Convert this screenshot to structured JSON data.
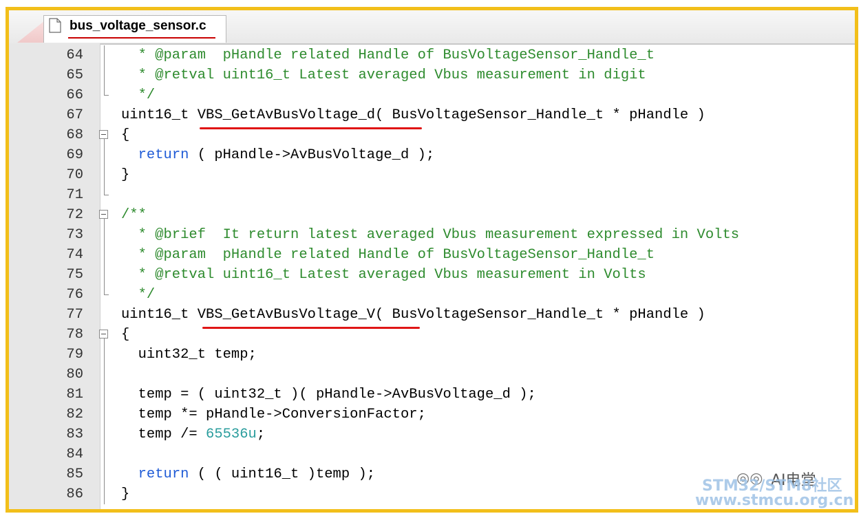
{
  "tab": {
    "filename": "bus_voltage_sensor.c"
  },
  "lines": [
    {
      "num": "64",
      "fold": "bar",
      "tokens": [
        [
          "cm",
          "  * @param  pHandle related Handle of BusVoltageSensor_Handle_t"
        ]
      ]
    },
    {
      "num": "65",
      "fold": "bar",
      "tokens": [
        [
          "cm",
          "  * @retval uint16_t Latest averaged Vbus measurement in digit"
        ]
      ]
    },
    {
      "num": "66",
      "fold": "end",
      "tokens": [
        [
          "cm",
          "  */"
        ]
      ]
    },
    {
      "num": "67",
      "fold": "none",
      "tokens": [
        [
          "",
          "uint16_t VBS_GetAvBusVoltage_d( BusVoltageSensor_Handle_t * pHandle )"
        ]
      ]
    },
    {
      "num": "68",
      "fold": "box",
      "tokens": [
        [
          "",
          "{"
        ]
      ]
    },
    {
      "num": "69",
      "fold": "bar",
      "tokens": [
        [
          "",
          "  "
        ],
        [
          "kw",
          "return"
        ],
        [
          "",
          " ( pHandle->AvBusVoltage_d );"
        ]
      ]
    },
    {
      "num": "70",
      "fold": "bar",
      "tokens": [
        [
          "",
          "}"
        ]
      ]
    },
    {
      "num": "71",
      "fold": "end",
      "tokens": [
        [
          "",
          ""
        ]
      ]
    },
    {
      "num": "72",
      "fold": "box",
      "tokens": [
        [
          "cm",
          "/**"
        ]
      ]
    },
    {
      "num": "73",
      "fold": "bar",
      "tokens": [
        [
          "cm",
          "  * @brief  It return latest averaged Vbus measurement expressed in Volts"
        ]
      ]
    },
    {
      "num": "74",
      "fold": "bar",
      "tokens": [
        [
          "cm",
          "  * @param  pHandle related Handle of BusVoltageSensor_Handle_t"
        ]
      ]
    },
    {
      "num": "75",
      "fold": "bar",
      "tokens": [
        [
          "cm",
          "  * @retval uint16_t Latest averaged Vbus measurement in Volts"
        ]
      ]
    },
    {
      "num": "76",
      "fold": "end",
      "tokens": [
        [
          "cm",
          "  */"
        ]
      ]
    },
    {
      "num": "77",
      "fold": "none",
      "tokens": [
        [
          "",
          "uint16_t VBS_GetAvBusVoltage_V( BusVoltageSensor_Handle_t * pHandle )"
        ]
      ]
    },
    {
      "num": "78",
      "fold": "box",
      "tokens": [
        [
          "",
          "{"
        ]
      ]
    },
    {
      "num": "79",
      "fold": "bar",
      "tokens": [
        [
          "",
          "  uint32_t temp;"
        ]
      ]
    },
    {
      "num": "80",
      "fold": "bar",
      "tokens": [
        [
          "",
          ""
        ]
      ]
    },
    {
      "num": "81",
      "fold": "bar",
      "tokens": [
        [
          "",
          "  temp = ( uint32_t )( pHandle->AvBusVoltage_d );"
        ]
      ]
    },
    {
      "num": "82",
      "fold": "bar",
      "tokens": [
        [
          "",
          "  temp *= pHandle->ConversionFactor;"
        ]
      ]
    },
    {
      "num": "83",
      "fold": "bar",
      "tokens": [
        [
          "",
          "  temp /= "
        ],
        [
          "num",
          "65536u"
        ],
        [
          "",
          ";"
        ]
      ]
    },
    {
      "num": "84",
      "fold": "bar",
      "tokens": [
        [
          "",
          ""
        ]
      ]
    },
    {
      "num": "85",
      "fold": "bar",
      "tokens": [
        [
          "",
          "  "
        ],
        [
          "kw",
          "return"
        ],
        [
          "",
          " ( ( uint16_t )temp );"
        ]
      ]
    },
    {
      "num": "86",
      "fold": "bar",
      "tokens": [
        [
          "",
          "}"
        ]
      ]
    }
  ],
  "watermark": {
    "icon": "wechat-icon",
    "brand": "AI电堂",
    "site_line1": "STM32/STM8社区",
    "site_line2": "www.stmcu.org.cn"
  },
  "colors": {
    "frame": "#f2bf1a",
    "comment": "#2e8b2e",
    "keyword": "#1f5bd6",
    "number": "#2a9d9d",
    "highlight_underline": "#e01515"
  }
}
